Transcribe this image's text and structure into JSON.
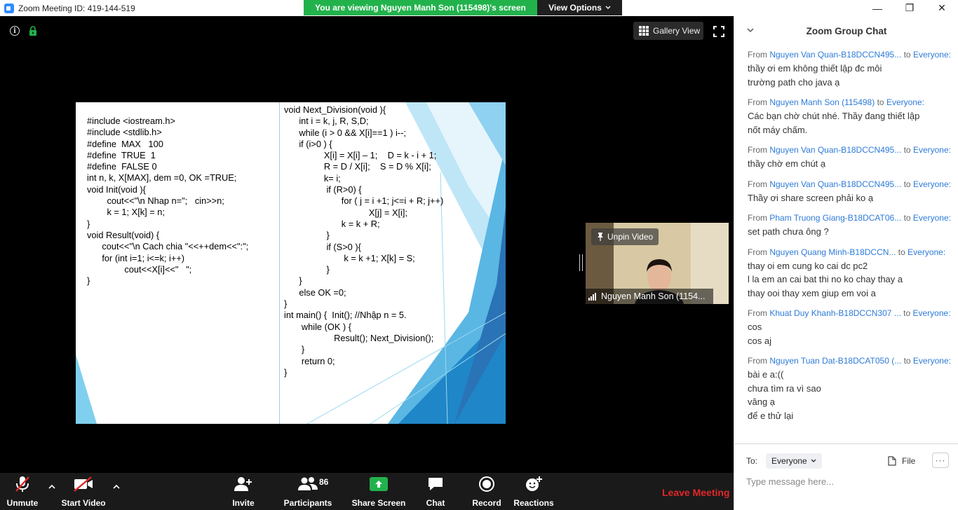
{
  "window": {
    "title": "Zoom Meeting ID: 419-144-519",
    "minimize": "—",
    "maximize": "❐",
    "close": "✕"
  },
  "banner": {
    "viewing_text": "You are viewing Nguyen Manh Son (115498)'s screen",
    "view_options": "View Options"
  },
  "video": {
    "gallery_view": "Gallery View"
  },
  "slide": {
    "left_code": "#include <iostream.h>\n#include <stdlib.h>\n#define  MAX   100\n#define  TRUE  1\n#define  FALSE 0\nint n, k, X[MAX], dem =0, OK =TRUE;\nvoid Init(void ){\n        cout<<\"\\n Nhap n=\";   cin>>n;\n        k = 1; X[k] = n;\n}\nvoid Result(void) {\n      cout<<\"\\n Cach chia \"<<++dem<<\":\";\n      for (int i=1; i<=k; i++)\n               cout<<X[i]<<\"   \";\n}",
    "right_code": "void Next_Division(void ){\n      int i = k, j, R, S,D;\n      while (i > 0 && X[i]==1 ) i--;\n      if (i>0 ) {\n                X[i] = X[i] – 1;    D = k - i + 1;\n                R = D / X[i];    S = D % X[i];\n                k= i;\n                 if (R>0) {\n                       for ( j = i +1; j<=i + R; j++)\n                                  X[j] = X[i];\n                       k = k + R;\n                 }\n                 if (S>0 ){\n                        k = k +1; X[k] = S;\n                 }\n      }\n      else OK =0;\n}\nint main() {  Init(); //Nhập n = 5.\n       while (OK ) {\n                    Result(); Next_Division();\n       }\n       return 0;\n}"
  },
  "speaker": {
    "unpin_label": "Unpin Video",
    "name": "Nguyen Manh Son (1154..."
  },
  "toolbar": {
    "unmute": "Unmute",
    "start_video": "Start Video",
    "invite": "Invite",
    "participants": "Participants",
    "participant_count": "86",
    "share_screen": "Share Screen",
    "chat": "Chat",
    "record": "Record",
    "reactions": "Reactions",
    "leave": "Leave Meeting"
  },
  "chat": {
    "title": "Zoom Group Chat",
    "from_prefix": "From",
    "to_word": "to",
    "to_label": "To:",
    "recipient": "Everyone",
    "file_label": "File",
    "more": "···",
    "input_placeholder": "Type message here...",
    "messages": [
      {
        "sender": "Nguyen Van Quan-B18DCCN495...",
        "to": "Everyone:",
        "lines": [
          "thầy ơi em không thiết lập đc môi",
          "trường path cho java ạ"
        ]
      },
      {
        "sender": "Nguyen Manh Son (115498)",
        "to": "Everyone:",
        "lines": [
          "Các bạn chờ chút nhé. Thầy đang thiết lập",
          "nốt máy chấm."
        ]
      },
      {
        "sender": "Nguyen Van Quan-B18DCCN495...",
        "to": "Everyone:",
        "lines": [
          "thầy chờ em chút ạ"
        ]
      },
      {
        "sender": "Nguyen Van Quan-B18DCCN495...",
        "to": "Everyone:",
        "lines": [
          "Thầy ơi share screen phải ko ạ"
        ]
      },
      {
        "sender": "Pham Truong Giang-B18DCAT06...",
        "to": "Everyone:",
        "lines": [
          "set path chưa ông ?"
        ]
      },
      {
        "sender": "Nguyen Quang Minh-B18DCCN...",
        "to": "Everyone:",
        "lines": [
          "thay oi em cung ko cai dc pc2",
          "l la em an cai bat thi no ko chay thay a",
          "thay ooi thay xem giup em voi a"
        ]
      },
      {
        "sender": "Khuat Duy Khanh-B18DCCN307 ...",
        "to": "Everyone:",
        "lines": [
          "cos",
          "cos aj"
        ]
      },
      {
        "sender": "Nguyen Tuan Dat-B18DCAT050 (...",
        "to": "Everyone:",
        "lines": [
          "bài e a:((",
          "chưa tìm ra vì sao",
          "vâng ạ",
          "để e thử lại"
        ]
      }
    ]
  },
  "colors": {
    "banner_green": "#22b24c",
    "leave_red": "#e02828",
    "chat_link_blue": "#2d7bd8"
  }
}
